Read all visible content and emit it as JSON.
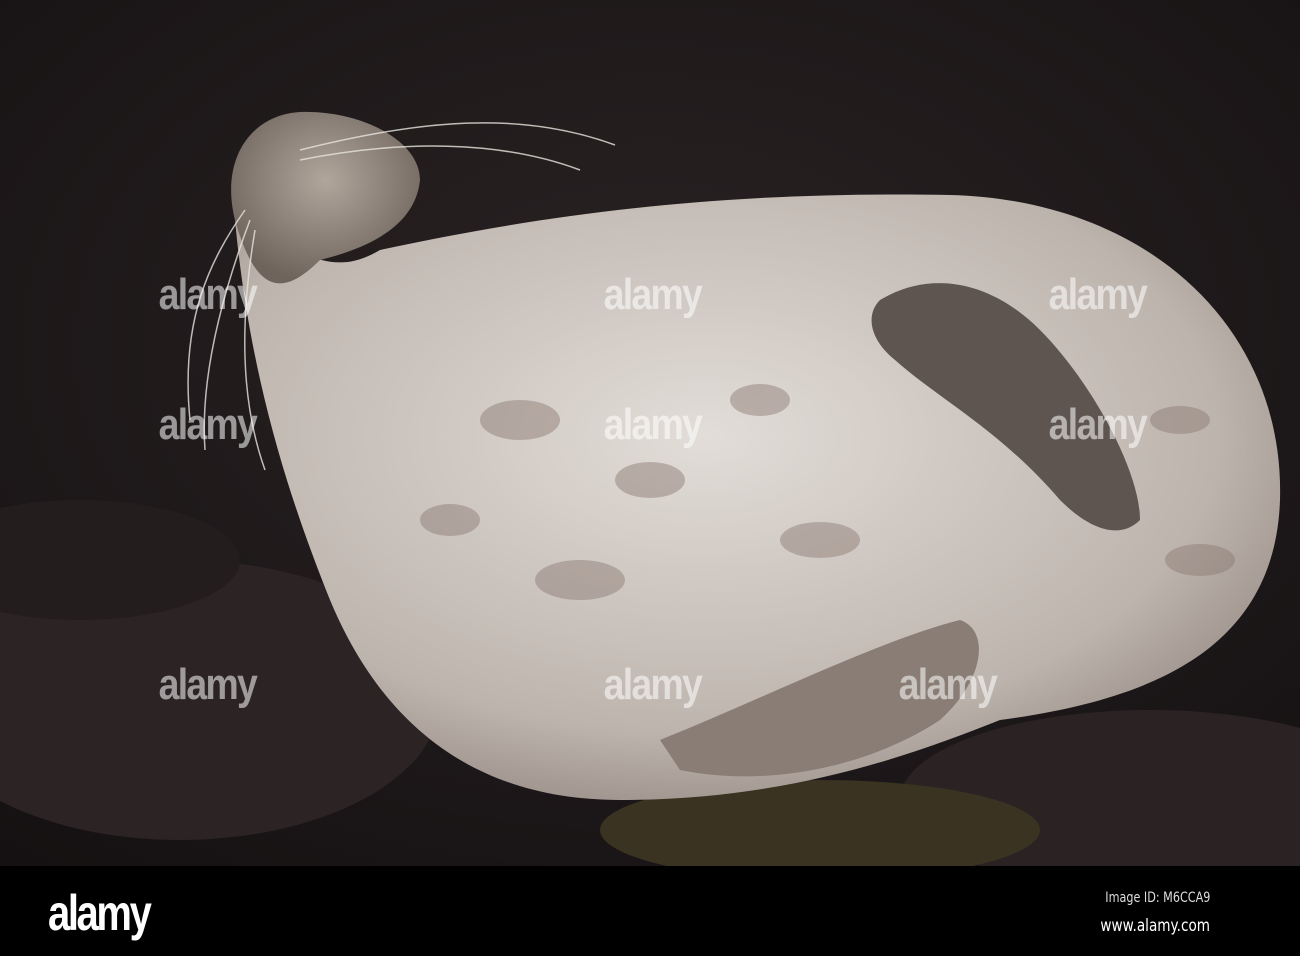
{
  "photo": {
    "subject": "seal",
    "colors": {
      "background": "#1f1a1b",
      "rock": "#2e2627",
      "fur": "#cfc9c3",
      "spots": "#8a7870",
      "flipper": "#5e5450"
    }
  },
  "watermark": {
    "text": "alamy"
  },
  "footer": {
    "logo": "alamy",
    "image_id": "Image ID: M6CCA9",
    "website": "www.alamy.com"
  }
}
